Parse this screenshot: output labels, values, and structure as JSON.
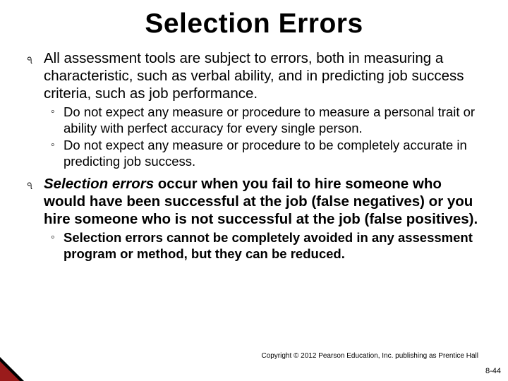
{
  "title": "Selection Errors",
  "bullets": {
    "b1": "All assessment tools are subject to errors, both in measuring a characteristic, such as verbal ability, and in predicting job success criteria, such as job performance.",
    "b1_sub1": "Do not expect any measure or procedure to measure a personal trait or ability with perfect accuracy for every single person.",
    "b1_sub2": "Do not expect any measure or procedure to be completely accurate in predicting job success.",
    "b2_lead": "Selection errors",
    "b2_rest": " occur when you fail to hire someone who would have been successful at the job (false negatives) or you hire someone who is not successful at the job (false positives).",
    "b2_sub1": "Selection errors cannot be completely avoided in any assessment program or method, but they can be reduced."
  },
  "footer": {
    "copyright": "Copyright © 2012 Pearson Education, Inc. publishing as Prentice Hall",
    "page": "8-44"
  },
  "glyphs": {
    "l1": "ঀ",
    "l2": "◦"
  }
}
